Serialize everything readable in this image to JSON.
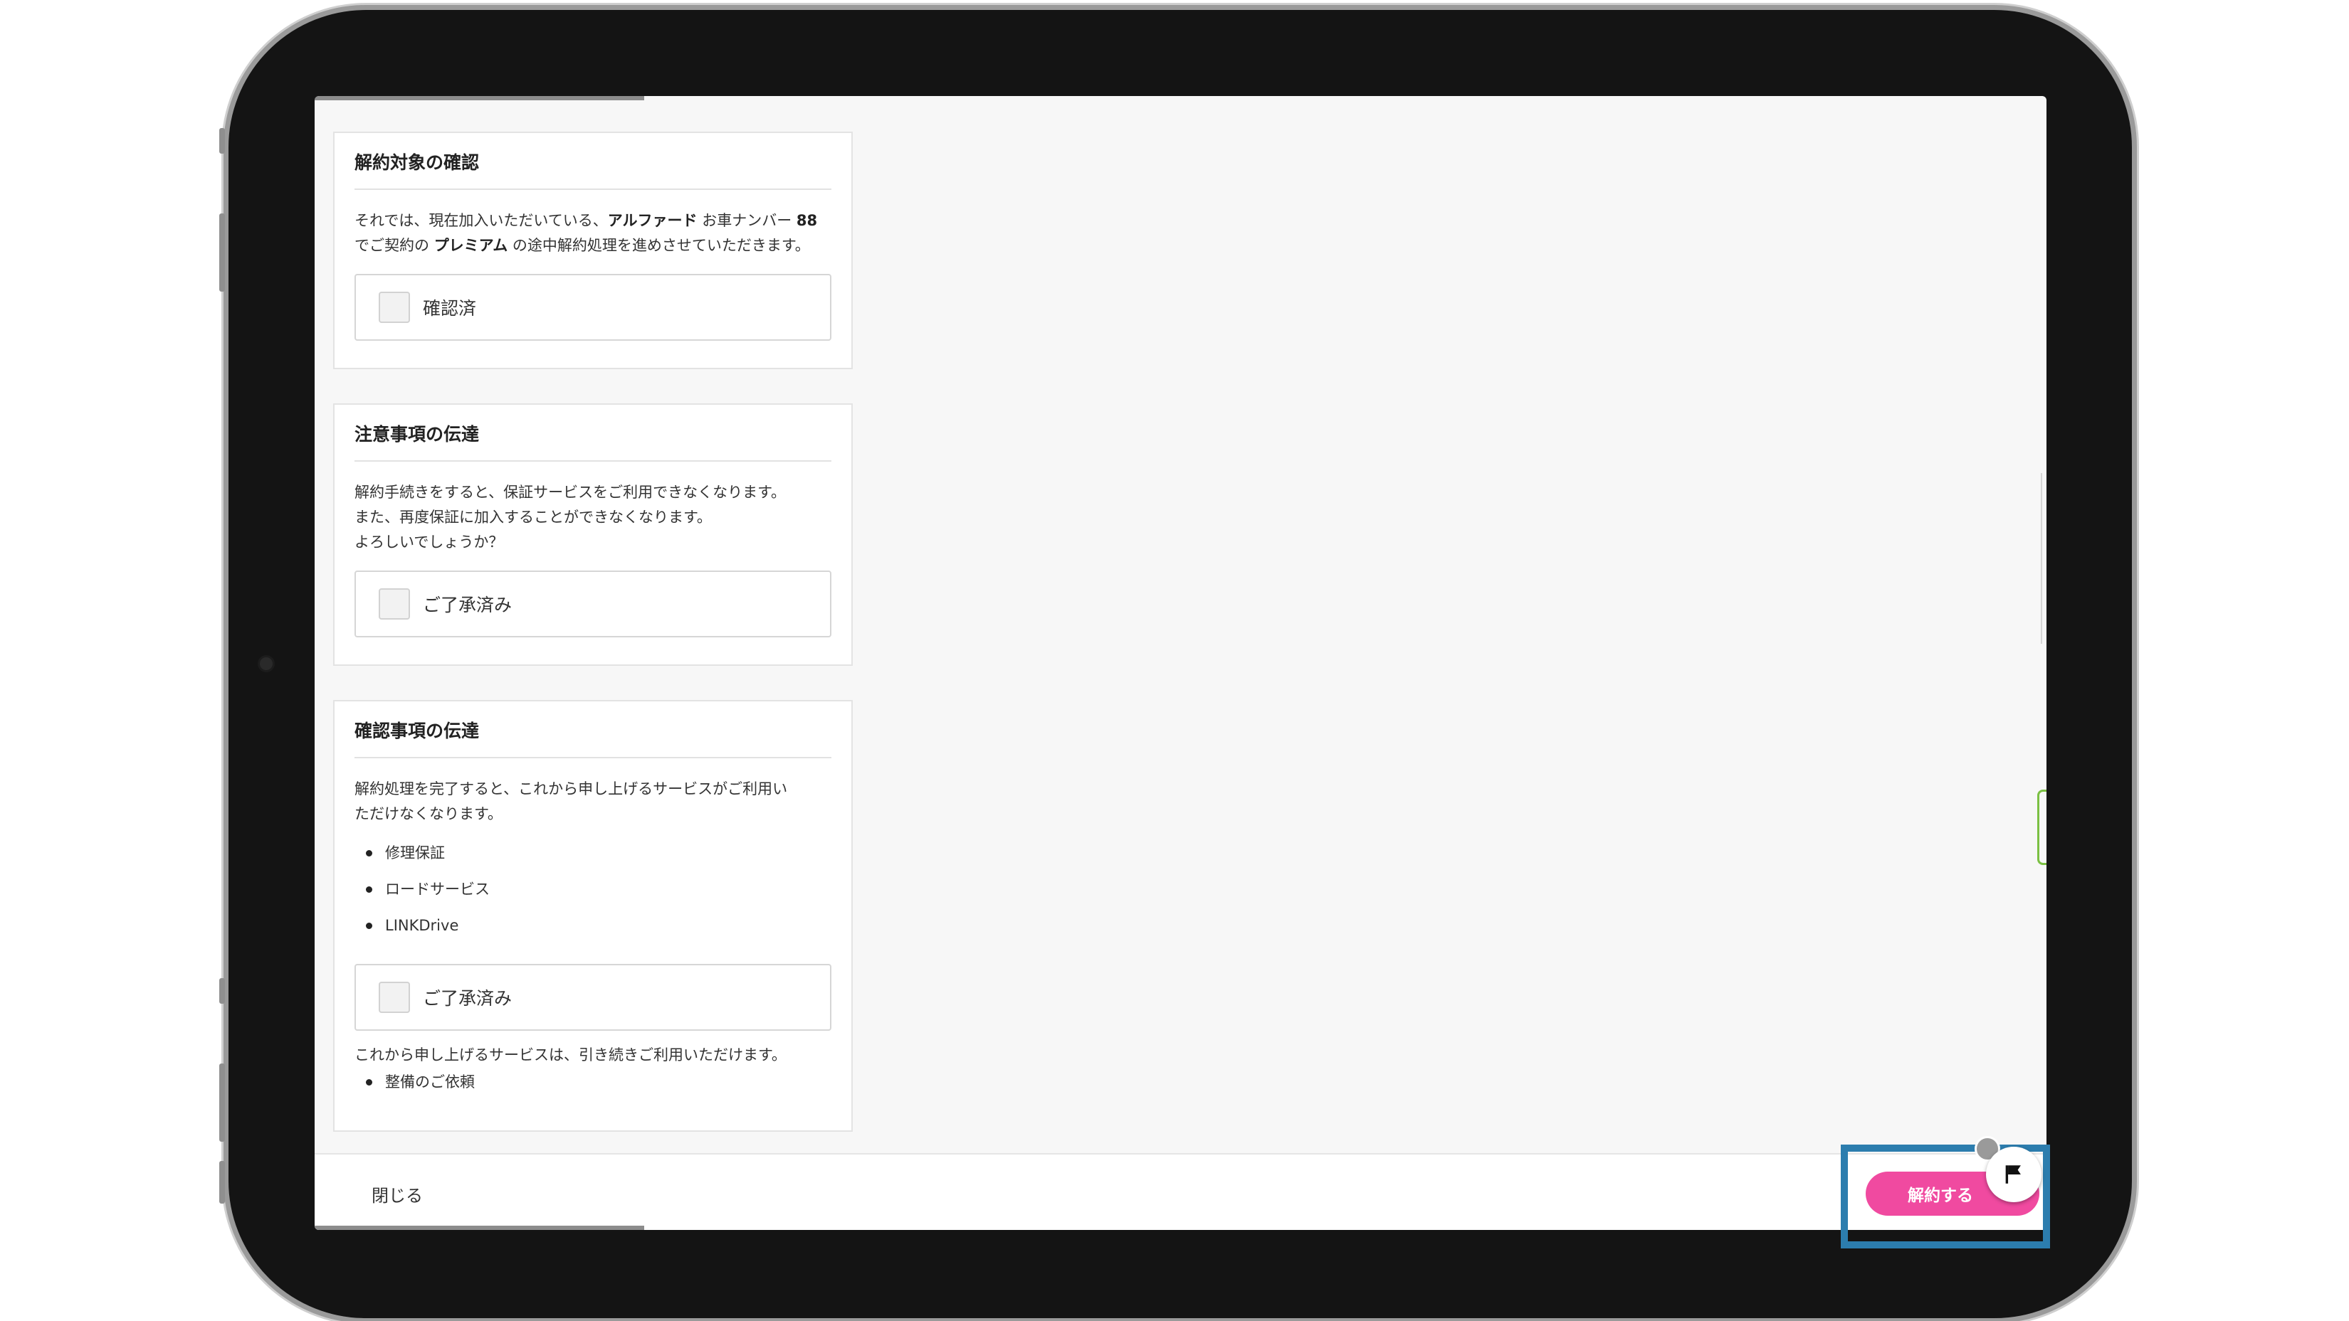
{
  "sections": [
    {
      "title": "解約対象の確認",
      "body_parts": [
        "それでは、現在加入いただいている、",
        "アルファード",
        " お車ナンバー ",
        "88",
        " でご契約の ",
        "プレミアム",
        " の途中解約処理を進めさせていただきます。"
      ],
      "checkbox_label": "確認済"
    },
    {
      "title": "注意事項の伝達",
      "lines": [
        "解約手続きをすると、保証サービスをご利用できなくなります。",
        "また、再度保証に加入することができなくなります。",
        "よろしいでしょうか？"
      ],
      "checkbox_label": "ご了承済み"
    },
    {
      "title": "確認事項の伝達",
      "lines": [
        "解約処理を完了すると、これから申し上げるサービスがご利用い",
        "ただけなくなります。"
      ],
      "services": [
        "修理保証",
        "ロードサービス",
        "LINKDrive"
      ],
      "checkbox_label": "ご了承済み",
      "continuing_text": "これから申し上げるサービスは、引き続きご利用いただけます。",
      "continuing_services": [
        "整備のご依頼"
      ]
    }
  ],
  "footer": {
    "close_label": "閉じる",
    "cancel_label": "解約する"
  },
  "colors": {
    "accent_pink": "#f04aa0",
    "highlight_blue": "#2c7dae",
    "frame": "#141414"
  },
  "icons": {
    "flag": "flag-icon"
  }
}
